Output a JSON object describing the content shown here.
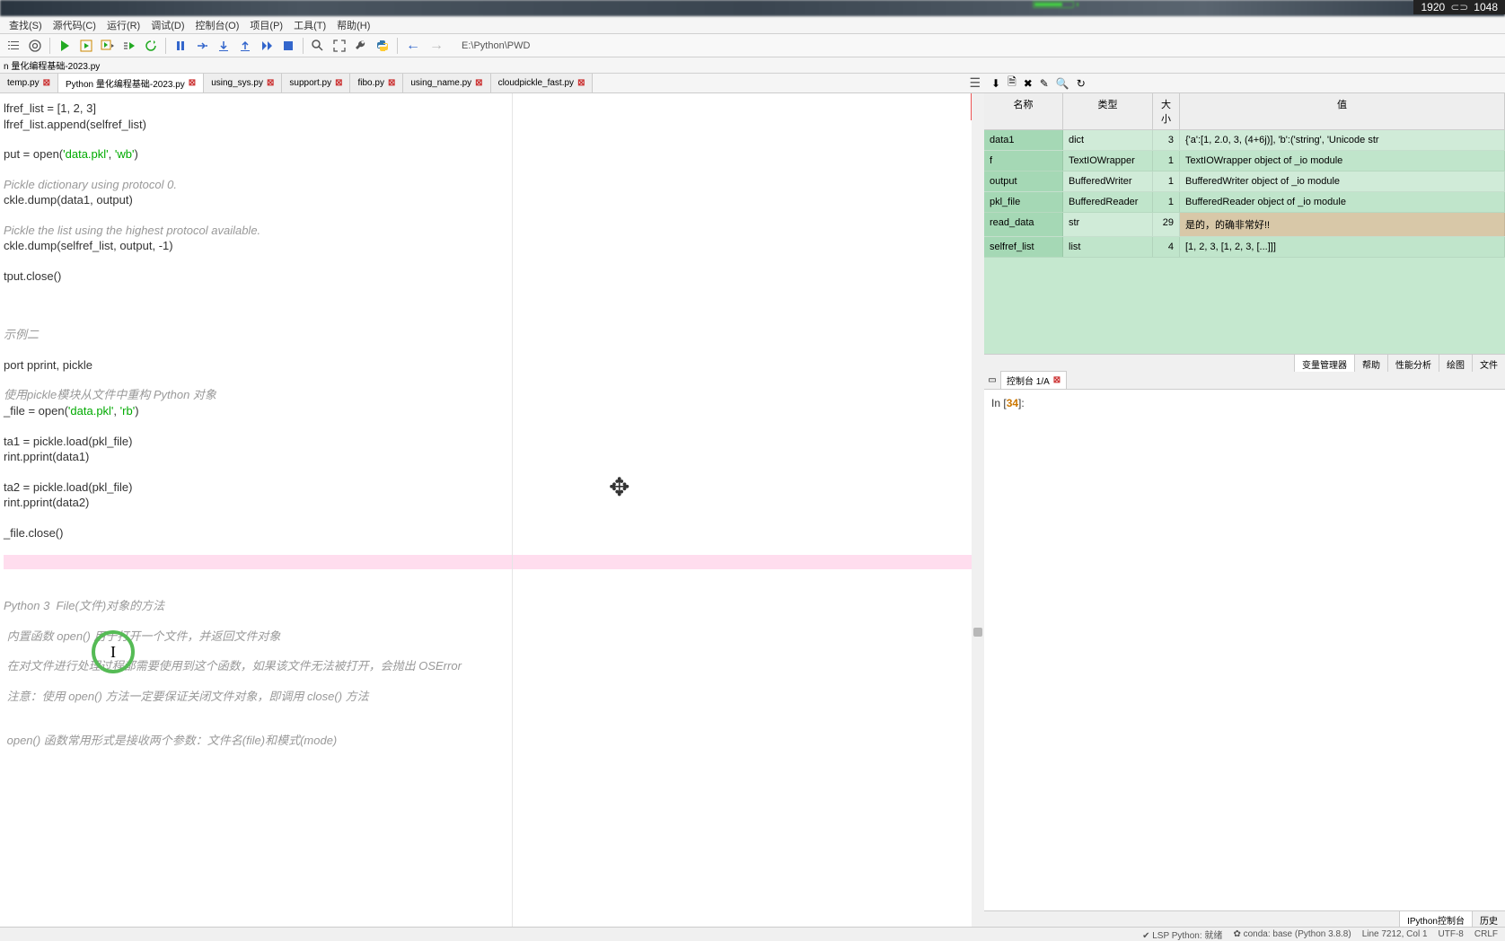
{
  "resolution": {
    "w": "1920",
    "h": "1048"
  },
  "menubar": [
    "查找(S)",
    "源代码(C)",
    "运行(R)",
    "调试(D)",
    "控制台(O)",
    "项目(P)",
    "工具(T)",
    "帮助(H)"
  ],
  "tabstrip_top": "n 量化编程基础-2023.py",
  "path": "E:\\Python\\PWD",
  "editor_tabs": [
    {
      "label": "temp.py",
      "active": false
    },
    {
      "label": "Python 量化编程基础-2023.py",
      "active": true
    },
    {
      "label": "using_sys.py",
      "active": false
    },
    {
      "label": "support.py",
      "active": false
    },
    {
      "label": "fibo.py",
      "active": false
    },
    {
      "label": "using_name.py",
      "active": false
    },
    {
      "label": "cloudpickle_fast.py",
      "active": false
    }
  ],
  "code_lines": [
    {
      "t": "lfref_list = [1, 2, 3]"
    },
    {
      "t": "lfref_list.append(selfref_list)"
    },
    {
      "t": ""
    },
    {
      "t": "put = open('data.pkl', 'wb')",
      "s": true
    },
    {
      "t": ""
    },
    {
      "t": "Pickle dictionary using protocol 0.",
      "c": true
    },
    {
      "t": "ckle.dump(data1, output)"
    },
    {
      "t": ""
    },
    {
      "t": "Pickle the list using the highest protocol available.",
      "c": true
    },
    {
      "t": "ckle.dump(selfref_list, output, -1)"
    },
    {
      "t": ""
    },
    {
      "t": "tput.close()"
    },
    {
      "t": ""
    },
    {
      "t": ""
    },
    {
      "t": ""
    },
    {
      "t": "示例二",
      "c": true
    },
    {
      "t": ""
    },
    {
      "t": "port pprint, pickle"
    },
    {
      "t": ""
    },
    {
      "t": "使用pickle模块从文件中重构 Python 对象",
      "c": true
    },
    {
      "t": "_file = open('data.pkl', 'rb')",
      "s": true
    },
    {
      "t": ""
    },
    {
      "t": "ta1 = pickle.load(pkl_file)"
    },
    {
      "t": "rint.pprint(data1)"
    },
    {
      "t": ""
    },
    {
      "t": "ta2 = pickle.load(pkl_file)"
    },
    {
      "t": "rint.pprint(data2)"
    },
    {
      "t": ""
    },
    {
      "t": "_file.close()"
    },
    {
      "t": ""
    },
    {
      "t": "",
      "hl": true
    },
    {
      "t": ""
    },
    {
      "t": ""
    },
    {
      "t": "Python 3  File(文件)对象的方法",
      "c": true
    },
    {
      "t": ""
    },
    {
      "t": " 内置函数 open() 用于打开一个文件，并返回文件对象",
      "c": true
    },
    {
      "t": ""
    },
    {
      "t": " 在对文件进行处理过程都需要使用到这个函数，如果该文件无法被打开，会抛出 OSError",
      "c": true
    },
    {
      "t": ""
    },
    {
      "t": " 注意：使用 open() 方法一定要保证关闭文件对象，即调用 close() 方法",
      "c": true
    },
    {
      "t": ""
    },
    {
      "t": ""
    },
    {
      "t": " open() 函数常用形式是接收两个参数：文件名(file)和模式(mode)",
      "c": true
    }
  ],
  "var_headers": {
    "name": "名称",
    "type": "类型",
    "size": "大小",
    "value": "值"
  },
  "variables": [
    {
      "name": "data1",
      "type": "dict",
      "size": "3",
      "value": "{'a':[1, 2.0, 3, (4+6j)], 'b':('string', 'Unicode str"
    },
    {
      "name": "f",
      "type": "TextIOWrapper",
      "size": "1",
      "value": "TextIOWrapper object of _io module"
    },
    {
      "name": "output",
      "type": "BufferedWriter",
      "size": "1",
      "value": "BufferedWriter object of _io module"
    },
    {
      "name": "pkl_file",
      "type": "BufferedReader",
      "size": "1",
      "value": "BufferedReader object of _io module"
    },
    {
      "name": "read_data",
      "type": "str",
      "size": "29",
      "value": "是的，的确非常好!!",
      "hl": true
    },
    {
      "name": "selfref_list",
      "type": "list",
      "size": "4",
      "value": "[1, 2, 3, [1, 2, 3, [...]]]"
    }
  ],
  "right_tabs": [
    "变量管理器",
    "帮助",
    "性能分析",
    "绘图",
    "文件"
  ],
  "console_tab": "控制台 1/A",
  "console_prompt_in": "In [",
  "console_prompt_num": "34",
  "console_prompt_close": "]:",
  "console_bottom_tabs": [
    "IPython控制台",
    "历史"
  ],
  "statusbar": {
    "lsp": "LSP Python: 就绪",
    "conda": "conda: base (Python 3.8.8)",
    "pos": "Line 7212, Col 1",
    "enc": "UTF-8",
    "eol": "CRLF"
  }
}
